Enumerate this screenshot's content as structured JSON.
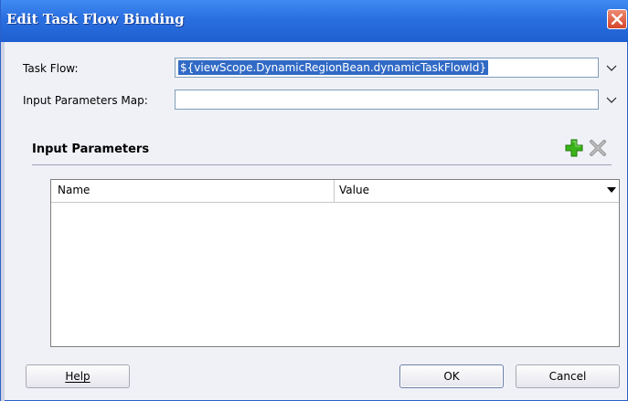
{
  "dialog": {
    "title": "Edit Task Flow Binding"
  },
  "fields": {
    "task_flow_label": "Task Flow:",
    "task_flow_value": "${viewScope.DynamicRegionBean.dynamicTaskFlowId}",
    "input_params_map_label": "Input Parameters Map:",
    "input_params_map_value": ""
  },
  "section": {
    "title": "Input Parameters"
  },
  "table": {
    "columns": [
      "Name",
      "Value"
    ],
    "rows": []
  },
  "buttons": {
    "help": "Help",
    "ok": "OK",
    "cancel": "Cancel"
  },
  "icons": {
    "add": "green-plus-icon",
    "delete": "gray-x-icon",
    "close": "close-icon"
  },
  "colors": {
    "titlebar": "#2a6fe0",
    "selection": "#316ac5",
    "close_button": "#d6452b",
    "add_icon": "#3bb31a"
  }
}
